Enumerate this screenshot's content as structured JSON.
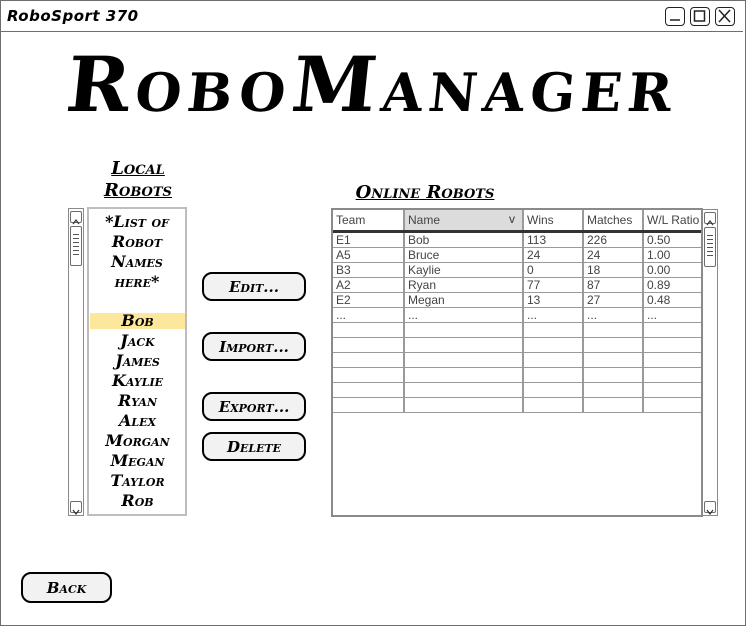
{
  "window": {
    "title": "RoboSport 370",
    "controls": [
      "minimize-icon",
      "maximize-icon",
      "close-icon"
    ]
  },
  "app_title": "RoboManager",
  "local": {
    "label_line1": "Local",
    "label_line2": "Robots",
    "placeholder_line1": "*List of",
    "placeholder_line2": "Robot",
    "placeholder_line3": "Names",
    "placeholder_line4": "here*",
    "items": [
      "Bob",
      "Jack",
      "James",
      "Kaylie",
      "Ryan",
      "Alex",
      "Morgan",
      "Megan",
      "Taylor",
      "Rob"
    ],
    "selected": "Bob",
    "selected_color": "#fde79d"
  },
  "buttons": {
    "edit": "Edit...",
    "import": "Import...",
    "export": "Export...",
    "delete": "Delete",
    "back": "Back"
  },
  "online": {
    "label": "Online Robots",
    "columns": [
      "Team",
      "Name",
      "Wins",
      "Matches",
      "W/L Ratio"
    ],
    "sorted_column": "Name",
    "sort_indicator": "v",
    "rows": [
      [
        "E1",
        "Bob",
        "113",
        "226",
        "0.50"
      ],
      [
        "A5",
        "Bruce",
        "24",
        "24",
        "1.00"
      ],
      [
        "B3",
        "Kaylie",
        "0",
        "18",
        "0.00"
      ],
      [
        "A2",
        "Ryan",
        "77",
        "87",
        "0.89"
      ],
      [
        "E2",
        "Megan",
        "13",
        "27",
        "0.48"
      ],
      [
        "...",
        "...",
        "...",
        "...",
        "..."
      ],
      [
        "",
        "",
        "",
        "",
        ""
      ],
      [
        "",
        "",
        "",
        "",
        ""
      ],
      [
        "",
        "",
        "",
        "",
        ""
      ],
      [
        "",
        "",
        "",
        "",
        ""
      ],
      [
        "",
        "",
        "",
        "",
        ""
      ],
      [
        "",
        "",
        "",
        "",
        ""
      ]
    ]
  }
}
